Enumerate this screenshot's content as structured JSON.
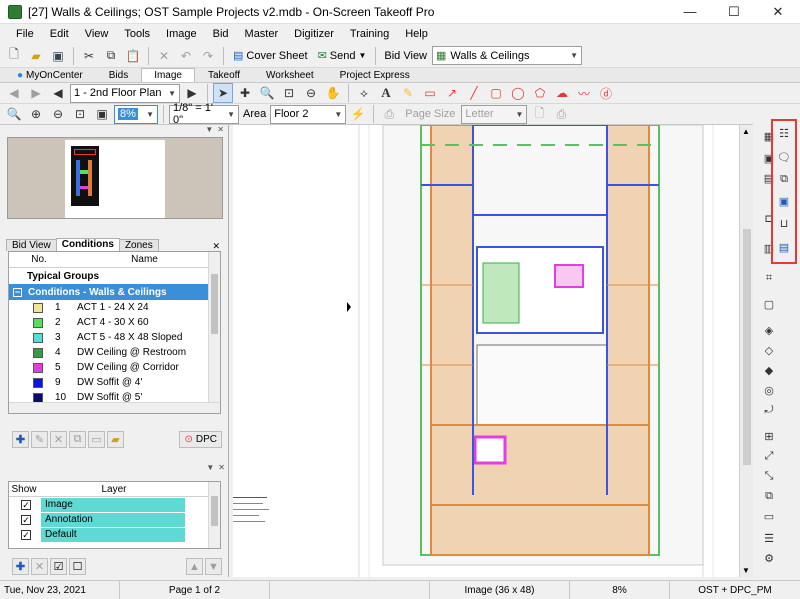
{
  "window": {
    "title": "[27] Walls & Ceilings; OST Sample Projects v2.mdb - On-Screen Takeoff Pro",
    "minimize": "—",
    "maximize": "☐",
    "close": "✕"
  },
  "menu": [
    "File",
    "Edit",
    "View",
    "Tools",
    "Image",
    "Bid",
    "Master",
    "Digitizer",
    "Training",
    "Help"
  ],
  "toolbar1": {
    "cover_sheet": "Cover Sheet",
    "send": "Send",
    "bid_view_label": "Bid View",
    "bid_view_value": "Walls & Ceilings"
  },
  "app_tabs": [
    "MyOnCenter",
    "Bids",
    "Image",
    "Takeoff",
    "Worksheet",
    "Project Express"
  ],
  "toolbar2": {
    "page_value": "1 - 2nd Floor Plan",
    "text_tool": "A"
  },
  "toolbar3": {
    "zoom_value": "8%",
    "scale_value": "1/8\" = 1' 0\"",
    "area_label": "Area",
    "area_value": "Floor 2",
    "page_size_label": "Page Size",
    "page_size_value": "Letter"
  },
  "subtabs": [
    "Bid View",
    "Conditions",
    "Zones"
  ],
  "conditions": {
    "col_no": "No.",
    "col_name": "Name",
    "typical_groups": "Typical Groups",
    "selected_group": "Conditions - Walls & Ceilings",
    "items": [
      {
        "no": "1",
        "name": "ACT 1 - 24 X 24",
        "color": "#f2e39b"
      },
      {
        "no": "2",
        "name": "ACT 4 - 30 X 60",
        "color": "#56e05a"
      },
      {
        "no": "3",
        "name": "ACT 5 - 48 X 48 Sloped",
        "color": "#4fe0d8"
      },
      {
        "no": "4",
        "name": "DW Ceiling @ Restroom",
        "color": "#3c9a45"
      },
      {
        "no": "5",
        "name": "DW Ceiling @ Corridor",
        "color": "#e23ee0"
      },
      {
        "no": "9",
        "name": "DW Soffit @ 4'",
        "color": "#1010e8"
      },
      {
        "no": "10",
        "name": "DW Soffit @ 5'",
        "color": "#0b0b6e"
      }
    ],
    "dpc_label": "DPC"
  },
  "layers": {
    "col_show": "Show",
    "col_layer": "Layer",
    "items": [
      {
        "name": "Image",
        "checked": "✓"
      },
      {
        "name": "Annotation",
        "checked": "✓"
      },
      {
        "name": "Default",
        "checked": "✓"
      }
    ]
  },
  "status": {
    "date": "Tue, Nov 23, 2021",
    "page": "Page 1 of 2",
    "image": "Image (36 x 48)",
    "zoom": "8%",
    "user": "OST + DPC_PM"
  }
}
